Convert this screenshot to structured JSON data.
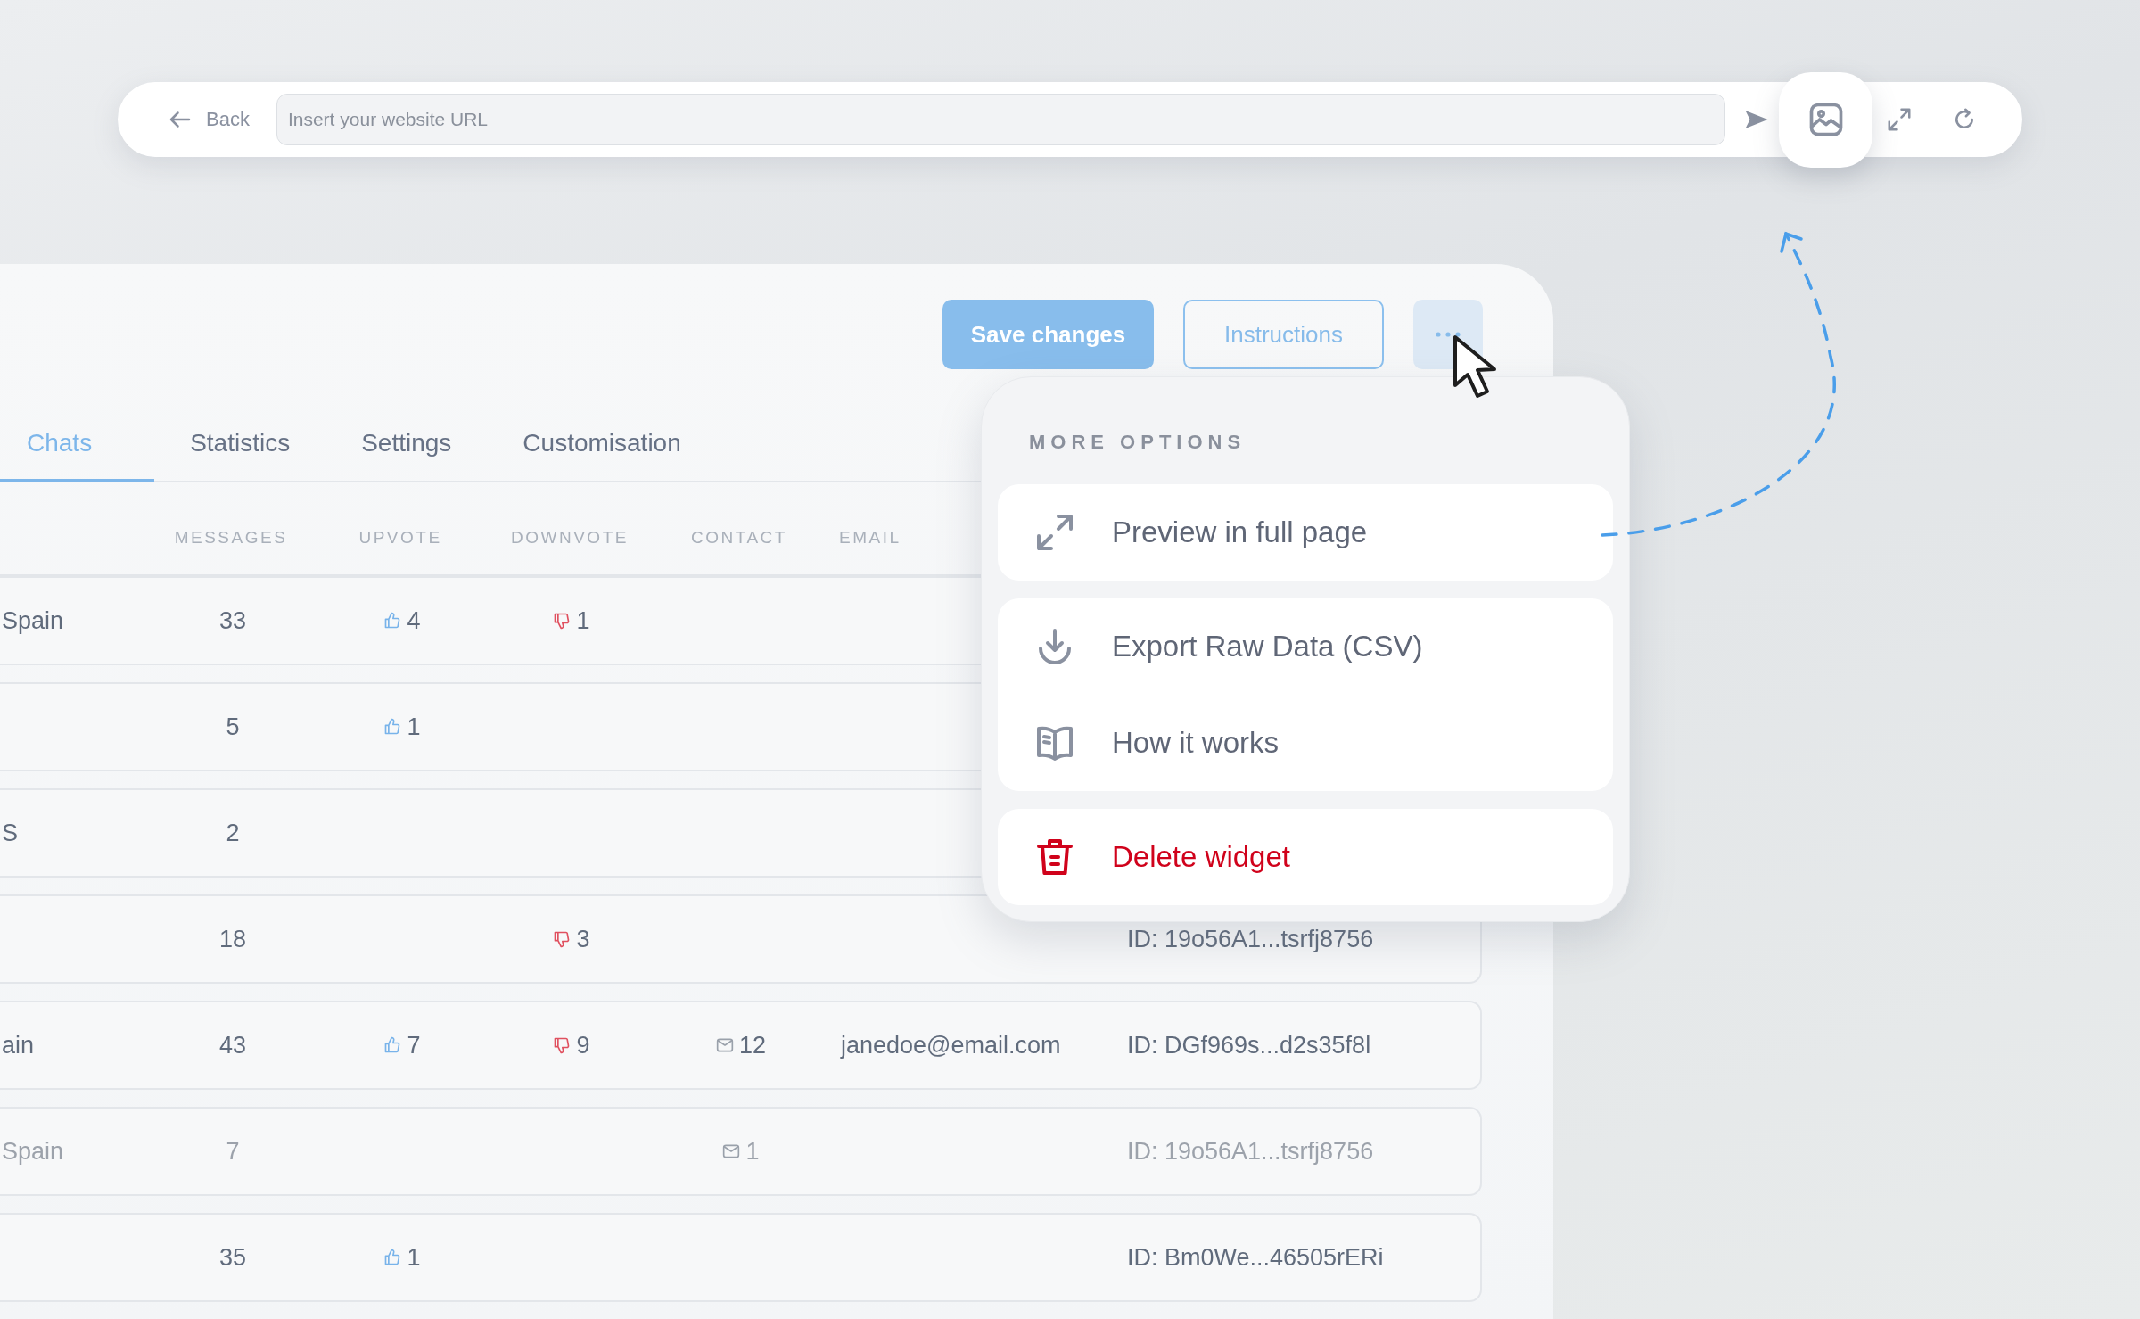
{
  "toolbar": {
    "back_label": "Back",
    "url_placeholder": "Insert your website URL",
    "image_view_active": true
  },
  "actions": {
    "save_label": "Save changes",
    "instructions_label": "Instructions",
    "menu_open": true
  },
  "tabs": [
    {
      "label": "Chats",
      "selected": true
    },
    {
      "label": "Statistics",
      "selected": false
    },
    {
      "label": "Settings",
      "selected": false
    },
    {
      "label": "Customisation",
      "selected": false
    }
  ],
  "table": {
    "columns": [
      "MESSAGES",
      "UPVOTE",
      "DOWNVOTE",
      "CONTACT",
      "EMAIL"
    ],
    "rows": [
      {
        "location": "Spain",
        "messages": "33",
        "upvotes": "4",
        "downvotes": "1",
        "dimmed": false
      },
      {
        "messages": "5",
        "upvotes": "1",
        "dimmed": false
      },
      {
        "location": "S",
        "messages": "2",
        "dimmed": false
      },
      {
        "messages": "18",
        "downvotes": "3",
        "id": "ID: 19o56A1...tsrfj8756",
        "dimmed": false
      },
      {
        "location": "ain",
        "messages": "43",
        "upvotes": "7",
        "downvotes": "9",
        "contacts": "12",
        "email": "janedoe@email.com",
        "id": "ID: DGf969s...d2s35f8l",
        "dimmed": false
      },
      {
        "location": "Spain",
        "messages": "7",
        "contacts": "1",
        "id": "ID: 19o56A1...tsrfj8756",
        "dimmed": true
      },
      {
        "messages": "35",
        "upvotes": "1",
        "id": "ID: Bm0We...46505rERi",
        "dimmed": false
      }
    ]
  },
  "menu": {
    "heading": "MORE OPTIONS",
    "groups": [
      [
        {
          "label": "Preview in full page",
          "kind": "normal"
        }
      ],
      [
        {
          "label": "Export Raw Data (CSV)",
          "kind": "normal"
        },
        {
          "label": "How it works",
          "kind": "normal"
        }
      ],
      [
        {
          "label": "Delete widget",
          "kind": "danger"
        }
      ]
    ]
  }
}
